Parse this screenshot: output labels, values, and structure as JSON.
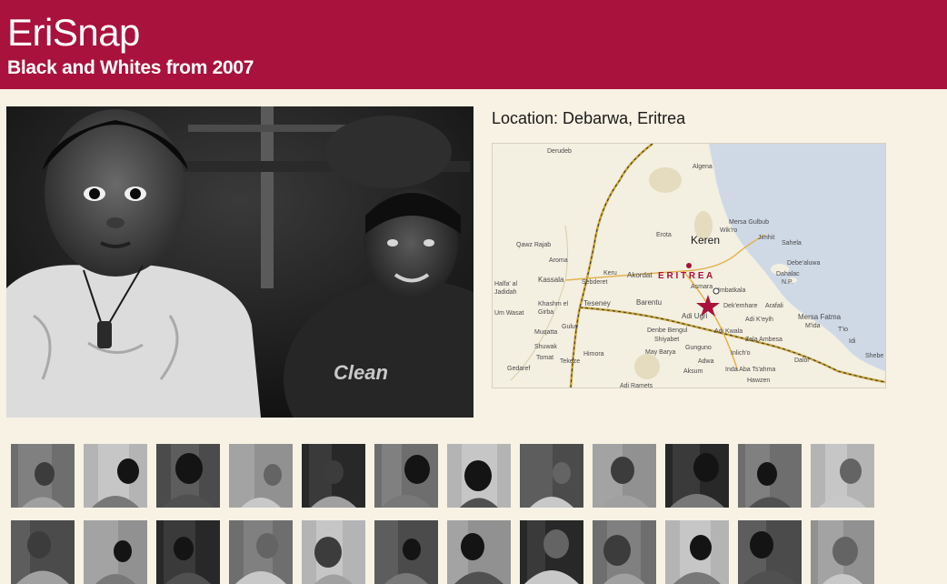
{
  "header": {
    "title": "EriSnap",
    "subtitle": "Black and Whites from 2007"
  },
  "photo": {
    "location_label": "Location: Debarwa, Eritrea"
  },
  "map": {
    "places": [
      "Derudeb",
      "Algena",
      "Mersa Gulbub",
      "Sahela",
      "Debe'aluwa",
      "Dahalac",
      "N.P.",
      "Jimhit",
      "Keren",
      "Erota",
      "Wik'ro",
      "Qawz Rajab",
      "Aroma",
      "Kassala",
      "Sebderet",
      "Keru",
      "Akordat",
      "E R I T R E A",
      "Asmara",
      "Imbatkala",
      "Halfa' al",
      "Jadidah",
      "Khashm el",
      "Girba",
      "Teseney",
      "Barentu",
      "Adi Ugri",
      "Dek'emhare",
      "Arafali",
      "Mersa Fatma",
      "Adi K'eyih",
      "Um Wasat",
      "Guluy",
      "Denbe Bengul",
      "Shiyabet",
      "Adi Kwala",
      "M'ida",
      "T'io",
      "Muqatta",
      "Shuwak",
      "Gunguno",
      "Zela Ambesa",
      "Idi",
      "Tomat",
      "Tekeze",
      "Himora",
      "May Barya",
      "Inlich'o",
      "Adwa",
      "Dalol",
      "Gedaref",
      "Aksum",
      "Inda Aba Ts'ahma",
      "Hawzen",
      "Shebe",
      "Adi Ramets"
    ]
  },
  "thumbnails": {
    "row1": [
      "Thumbnail 1",
      "Thumbnail 2",
      "Thumbnail 3",
      "Thumbnail 4",
      "Thumbnail 5",
      "Thumbnail 6",
      "Thumbnail 7",
      "Thumbnail 8",
      "Thumbnail 9",
      "Thumbnail 10",
      "Thumbnail 11",
      "Thumbnail 12"
    ],
    "row2": [
      "Thumbnail 13",
      "Thumbnail 14",
      "Thumbnail 15",
      "Thumbnail 16",
      "Thumbnail 17",
      "Thumbnail 18",
      "Thumbnail 19",
      "Thumbnail 20",
      "Thumbnail 21",
      "Thumbnail 22",
      "Thumbnail 23",
      "Thumbnail 24"
    ]
  },
  "colors": {
    "header_bg": "#a8123c",
    "page_bg": "#f8f2e4",
    "map_star": "#a8123c"
  }
}
